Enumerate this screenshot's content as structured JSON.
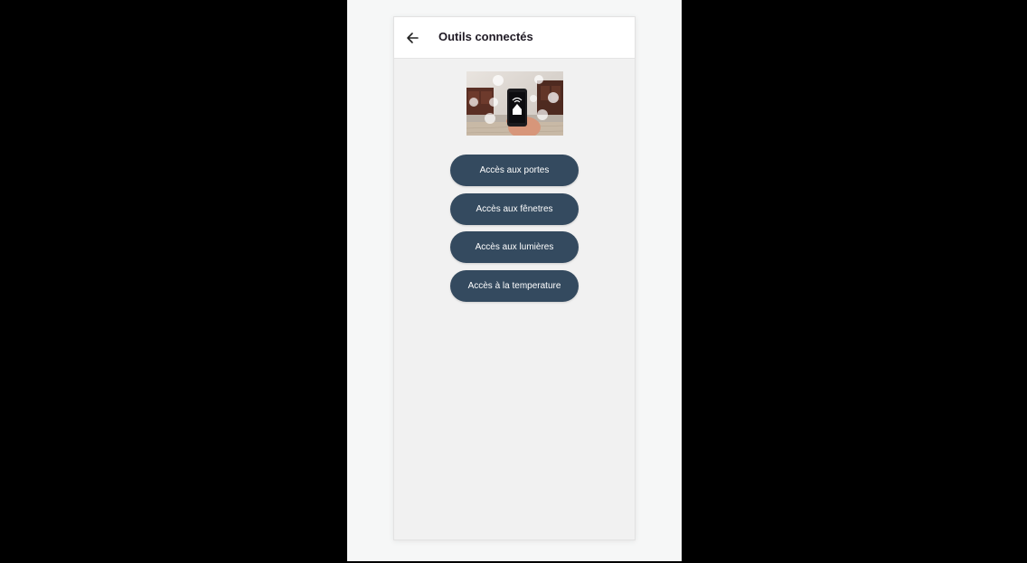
{
  "page": {
    "background": "#000000",
    "surface": "#f6f7f7"
  },
  "appbar": {
    "title": "Outils connectés",
    "back_icon": "arrow-left-icon"
  },
  "hero_image": {
    "icon": "smart-home-phone-image"
  },
  "actions": [
    {
      "label": "Accès aux portes"
    },
    {
      "label": "Accès aux fênetres"
    },
    {
      "label": "Accès aux lumières"
    },
    {
      "label": "Accès à la temperature"
    }
  ],
  "colors": {
    "button_bg": "#344a5f",
    "button_text": "#ffffff",
    "content_bg": "#f1f1f1",
    "appbar_bg": "#ffffff"
  }
}
